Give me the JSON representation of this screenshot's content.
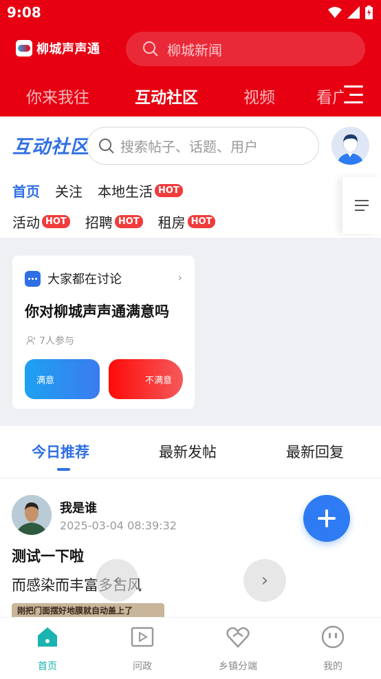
{
  "status": {
    "time": "9:08"
  },
  "header": {
    "app_name": "柳城声声通",
    "search_placeholder": "柳城新闻",
    "tabs": [
      "你来我往",
      "互动社区",
      "视频",
      "看广"
    ],
    "active_tab": "互动社区"
  },
  "community": {
    "title": "互动社区",
    "search_placeholder": "搜索帖子、话题、用户",
    "categories_row1": [
      {
        "label": "首页",
        "hot": false,
        "active": true
      },
      {
        "label": "关注",
        "hot": false
      },
      {
        "label": "本地生活",
        "hot": true
      }
    ],
    "categories_row2": [
      {
        "label": "活动",
        "hot": true
      },
      {
        "label": "招聘",
        "hot": true
      },
      {
        "label": "租房",
        "hot": true
      }
    ],
    "hot_label": "HOT"
  },
  "poll": {
    "heading": "大家都在讨论",
    "question": "你对柳城声声通满意吗",
    "participants": "7人参与",
    "option_yes": "满意",
    "option_no": "不满意"
  },
  "feed_tabs": [
    "今日推荐",
    "最新发帖",
    "最新回复"
  ],
  "post": {
    "author": "我是谁",
    "time": "2025-03-04 08:39:32",
    "title": "测试一下啦",
    "body": "而感染而丰富多古风",
    "image_caption": "刚把门面摆好地膜就自动盖上了"
  },
  "bottom_nav": [
    {
      "label": "首页",
      "icon": "home-icon",
      "active": true
    },
    {
      "label": "问政",
      "icon": "play-box-icon"
    },
    {
      "label": "乡镇分端",
      "icon": "heart-link-icon"
    },
    {
      "label": "我的",
      "icon": "smile-face-icon"
    }
  ],
  "colors": {
    "brand_red": "#e60012",
    "accent_blue": "#2f6fe4",
    "active_teal": "#19b3b0"
  }
}
